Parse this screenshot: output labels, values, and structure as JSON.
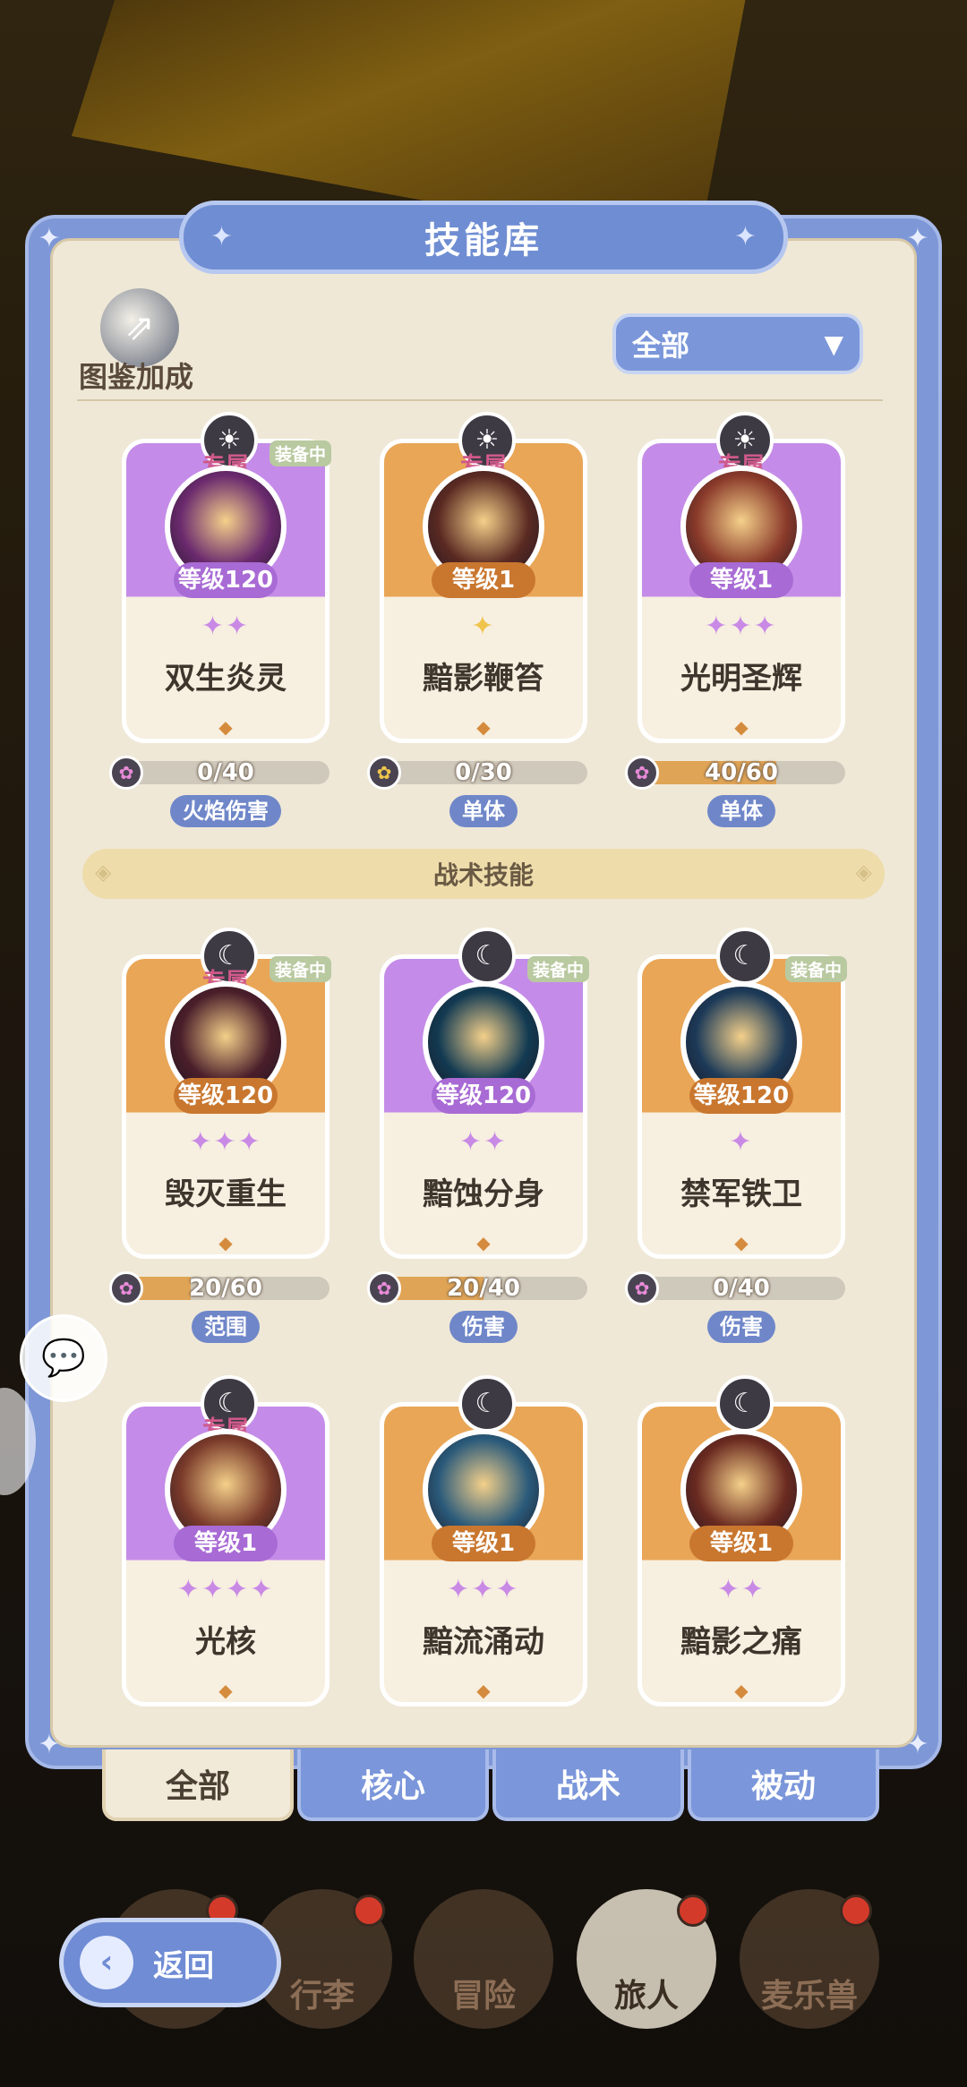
{
  "header": {
    "title": "技能库"
  },
  "codex": {
    "label": "图鉴加成"
  },
  "filter": {
    "selected": "全部"
  },
  "section": {
    "label": "战术技能"
  },
  "cards": [
    {
      "name": "双生炎灵",
      "level": "等级120",
      "exclusive": "专属",
      "equipped": "装备中",
      "stars": "✦✦",
      "progress": "0/40",
      "progress_frac": 0,
      "tag": "火焰伤害",
      "theme": "purple",
      "type_icon": "sun-icon",
      "orb_color": "#6b2a6e"
    },
    {
      "name": "黯影鞭笞",
      "level": "等级1",
      "exclusive": "专属",
      "equipped": "",
      "stars": "✦",
      "progress": "0/30",
      "progress_frac": 0,
      "tag": "单体",
      "theme": "orange",
      "type_icon": "sun-icon",
      "orb_color": "#5a2a22"
    },
    {
      "name": "光明圣辉",
      "level": "等级1",
      "exclusive": "专属",
      "equipped": "",
      "stars": "✦✦✦",
      "progress": "40/60",
      "progress_frac": 0.667,
      "tag": "单体",
      "theme": "purple",
      "type_icon": "sun-icon",
      "orb_color": "#8a3a2a"
    },
    {
      "name": "毁灭重生",
      "level": "等级120",
      "exclusive": "专属",
      "equipped": "装备中",
      "stars": "✦✦✦",
      "progress": "20/60",
      "progress_frac": 0.333,
      "tag": "范围",
      "theme": "orange",
      "type_icon": "moon-icon",
      "orb_color": "#4a1e2a"
    },
    {
      "name": "黯蚀分身",
      "level": "等级120",
      "exclusive": "",
      "equipped": "装备中",
      "stars": "✦✦",
      "progress": "20/40",
      "progress_frac": 0.5,
      "tag": "伤害",
      "theme": "purple",
      "type_icon": "moon-icon",
      "orb_color": "#123a52"
    },
    {
      "name": "禁军铁卫",
      "level": "等级120",
      "exclusive": "",
      "equipped": "装备中",
      "stars": "✦",
      "progress": "0/40",
      "progress_frac": 0,
      "tag": "伤害",
      "theme": "orange",
      "type_icon": "moon-icon",
      "orb_color": "#1c3a58"
    },
    {
      "name": "光核",
      "level": "等级1",
      "exclusive": "专属",
      "equipped": "",
      "stars": "✦✦✦✦",
      "progress": "",
      "progress_frac": 0,
      "tag": "",
      "theme": "purple",
      "type_icon": "moon-icon",
      "orb_color": "#7a3a2a"
    },
    {
      "name": "黯流涌动",
      "level": "等级1",
      "exclusive": "",
      "equipped": "",
      "stars": "✦✦✦",
      "progress": "",
      "progress_frac": 0,
      "tag": "",
      "theme": "orange",
      "type_icon": "moon-icon",
      "orb_color": "#2a5a7a"
    },
    {
      "name": "黯影之痛",
      "level": "等级1",
      "exclusive": "",
      "equipped": "",
      "stars": "✦✦",
      "progress": "",
      "progress_frac": 0,
      "tag": "",
      "theme": "orange",
      "type_icon": "moon-icon",
      "orb_color": "#6a2a20"
    }
  ],
  "tabs": [
    "全部",
    "核心",
    "战术",
    "被动"
  ],
  "back": {
    "label": "返回"
  },
  "bottom_nav": [
    "行李",
    "冒险",
    "旅人",
    "麦乐兽"
  ]
}
